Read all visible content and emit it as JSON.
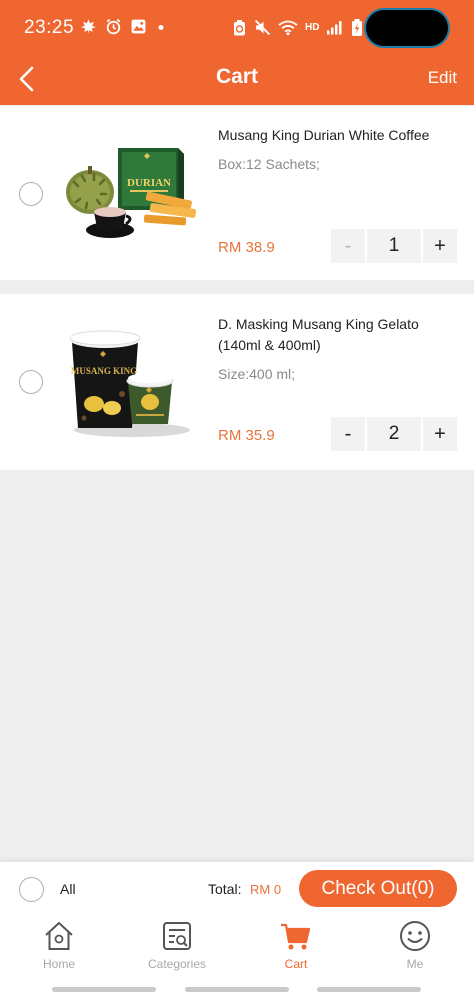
{
  "status_bar": {
    "time": "23:25",
    "network_label": "HD",
    "left_icons": [
      "leaf-icon",
      "alarm-icon",
      "gallery-icon",
      "dot-icon"
    ],
    "right_icons": [
      "battery-saver-icon",
      "mute-icon",
      "wifi-icon",
      "signal-icon",
      "battery-icon"
    ]
  },
  "header": {
    "title": "Cart",
    "edit_label": "Edit",
    "back_icon": "chevron-left-icon"
  },
  "cart": {
    "items": [
      {
        "name": "Musang King Durian White Coffee",
        "spec": "Box:12 Sachets;",
        "price": "RM 38.9",
        "quantity": "1",
        "minus_label": "-",
        "plus_label": "+",
        "minus_disabled": true
      },
      {
        "name": "D. Masking Musang King Gelato (140ml & 400ml)",
        "spec": "Size:400 ml;",
        "price": "RM 35.9",
        "quantity": "2",
        "minus_label": "-",
        "plus_label": "+",
        "minus_disabled": false,
        "image_text": "MUSANG KING"
      }
    ]
  },
  "checkout_bar": {
    "all_label": "All",
    "total_label": "Total:",
    "total_value": "RM 0",
    "checkout_label": "Check Out(0)"
  },
  "tabbar": {
    "tabs": [
      {
        "label": "Home",
        "icon": "home-icon",
        "active": false
      },
      {
        "label": "Categories",
        "icon": "categories-icon",
        "active": false
      },
      {
        "label": "Cart",
        "icon": "cart-icon",
        "active": true
      },
      {
        "label": "Me",
        "icon": "smiley-icon",
        "active": false
      }
    ]
  },
  "colors": {
    "brand": "#ef6631",
    "price": "#e8743a",
    "inactive": "#a8a8a8",
    "background": "#eeeeef"
  }
}
